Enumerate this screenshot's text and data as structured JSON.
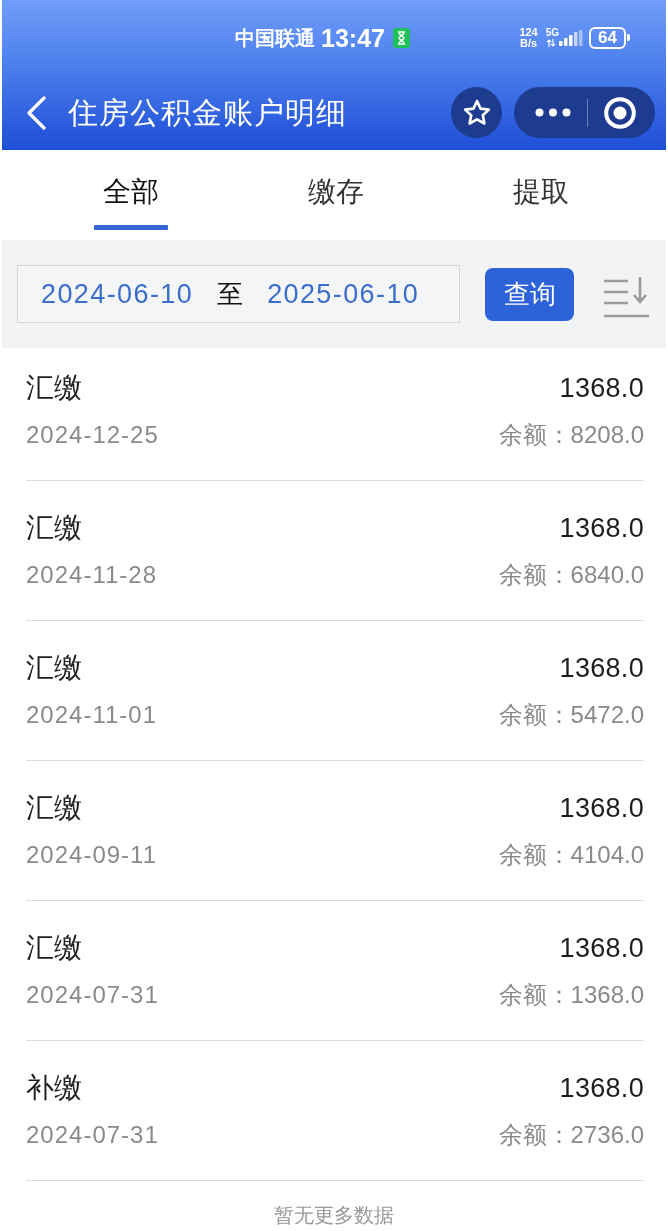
{
  "status_bar": {
    "carrier": "中国联通",
    "time": "13:47",
    "net_speed": "124",
    "net_unit": "B/s",
    "network": "5G",
    "battery": "64"
  },
  "header": {
    "title": "住房公积金账户明细"
  },
  "tabs": [
    {
      "label": "全部",
      "selected": true
    },
    {
      "label": "缴存",
      "selected": false
    },
    {
      "label": "提取",
      "selected": false
    }
  ],
  "filter": {
    "start_date": "2024-06-10",
    "separator": "至",
    "end_date": "2025-06-10",
    "button": "查询"
  },
  "records": [
    {
      "type": "汇缴",
      "date": "2024-12-25",
      "amount": "1368.0",
      "balance": "余额：8208.0"
    },
    {
      "type": "汇缴",
      "date": "2024-11-28",
      "amount": "1368.0",
      "balance": "余额：6840.0"
    },
    {
      "type": "汇缴",
      "date": "2024-11-01",
      "amount": "1368.0",
      "balance": "余额：5472.0"
    },
    {
      "type": "汇缴",
      "date": "2024-09-11",
      "amount": "1368.0",
      "balance": "余额：4104.0"
    },
    {
      "type": "汇缴",
      "date": "2024-07-31",
      "amount": "1368.0",
      "balance": "余额：1368.0"
    },
    {
      "type": "补缴",
      "date": "2024-07-31",
      "amount": "1368.0",
      "balance": "余额：2736.0"
    }
  ],
  "footer": "暂无更多数据"
}
